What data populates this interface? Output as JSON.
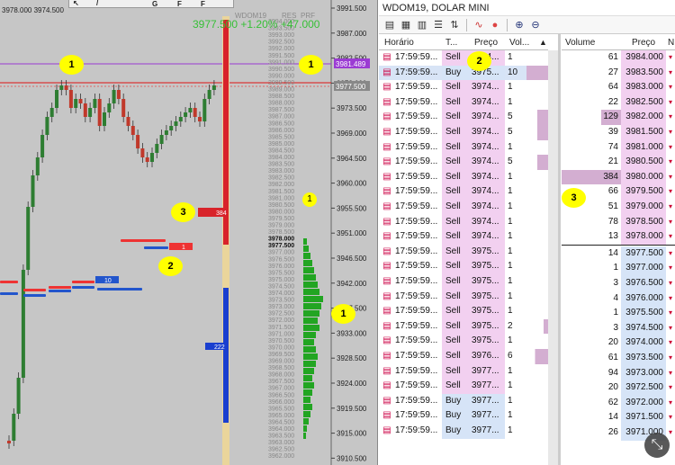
{
  "chart": {
    "header_left": "3978.000 3974.500",
    "toolbar": [
      "G",
      "F",
      "F"
    ],
    "top_info": "3977.500 +1.20% +47.000",
    "col_headers": [
      "WDOM19",
      "RES",
      "PRF"
    ],
    "price_labels": [
      "3991.500",
      "3987.000",
      "3982.500",
      "3978.000",
      "3973.500",
      "3969.000",
      "3964.500",
      "3960.000",
      "3955.500",
      "3951.000",
      "3946.500",
      "3942.000",
      "3937.500",
      "3933.000",
      "3928.500",
      "3924.000",
      "3919.500",
      "3915.000",
      "3910.500"
    ],
    "tag_purple": "3981.489",
    "tag_gray": "3977.500",
    "bar_label_blue": "10",
    "bar_label_red": "1",
    "bar_label_mid": "384",
    "bar_label_low": "222",
    "badges": [
      "1",
      "1",
      "1",
      "1",
      "2",
      "3"
    ],
    "dom_prices": [
      "3994.000",
      "3993.500",
      "3993.000",
      "3992.500",
      "3992.000",
      "3991.500",
      "3991.000",
      "3990.500",
      "3990.000",
      "3989.500",
      "3989.000",
      "3988.500",
      "3988.000",
      "3987.500",
      "3987.000",
      "3986.500",
      "3986.000",
      "3985.500",
      "3985.000",
      "3984.500",
      "3984.000",
      "3983.500",
      "3983.000",
      "3982.500",
      "3982.000",
      "3981.500",
      "3981.000",
      "3980.500",
      "3980.000",
      "3979.500",
      "3979.000",
      "3978.500",
      "3978.000",
      "3977.500",
      "3977.000",
      "3976.500",
      "3976.000",
      "3975.500",
      "3975.000",
      "3974.500",
      "3974.000",
      "3973.500",
      "3973.000",
      "3972.500",
      "3972.000",
      "3971.500",
      "3971.000",
      "3970.500",
      "3970.000",
      "3969.500",
      "3969.000",
      "3968.500",
      "3968.000",
      "3967.500",
      "3967.000",
      "3966.500",
      "3966.000",
      "3965.500",
      "3965.000",
      "3964.500",
      "3964.000",
      "3963.500",
      "3963.000",
      "3962.500",
      "3962.000"
    ]
  },
  "window": {
    "title": "WDOM19, DOLAR MINI",
    "toolbar_icons": [
      "chart-icon",
      "table-icon",
      "grid-icon",
      "list-icon",
      "sort-icon",
      "signal-icon",
      "filter-icon",
      "zoom-in-icon",
      "zoom-out-icon"
    ],
    "trades": {
      "headers": [
        "Horário",
        "T...",
        "Preço",
        "Vol..."
      ],
      "rows": [
        {
          "time": "17:59:59...",
          "type": "Sell",
          "price": "3974...",
          "vol": "1"
        },
        {
          "time": "17:59:59...",
          "type": "Buy",
          "price": "3975...",
          "vol": "10"
        },
        {
          "time": "17:59:59...",
          "type": "Sell",
          "price": "3974...",
          "vol": "1"
        },
        {
          "time": "17:59:59...",
          "type": "Sell",
          "price": "3974...",
          "vol": "1"
        },
        {
          "time": "17:59:59...",
          "type": "Sell",
          "price": "3974...",
          "vol": "5"
        },
        {
          "time": "17:59:59...",
          "type": "Sell",
          "price": "3974...",
          "vol": "5"
        },
        {
          "time": "17:59:59...",
          "type": "Sell",
          "price": "3974...",
          "vol": "1"
        },
        {
          "time": "17:59:59...",
          "type": "Sell",
          "price": "3974...",
          "vol": "5"
        },
        {
          "time": "17:59:59...",
          "type": "Sell",
          "price": "3974...",
          "vol": "1"
        },
        {
          "time": "17:59:59...",
          "type": "Sell",
          "price": "3974...",
          "vol": "1"
        },
        {
          "time": "17:59:59...",
          "type": "Sell",
          "price": "3974...",
          "vol": "1"
        },
        {
          "time": "17:59:59...",
          "type": "Sell",
          "price": "3974...",
          "vol": "1"
        },
        {
          "time": "17:59:59...",
          "type": "Sell",
          "price": "3974...",
          "vol": "1"
        },
        {
          "time": "17:59:59...",
          "type": "Sell",
          "price": "3975...",
          "vol": "1"
        },
        {
          "time": "17:59:59...",
          "type": "Sell",
          "price": "3975...",
          "vol": "1"
        },
        {
          "time": "17:59:59...",
          "type": "Sell",
          "price": "3975...",
          "vol": "1"
        },
        {
          "time": "17:59:59...",
          "type": "Sell",
          "price": "3975...",
          "vol": "1"
        },
        {
          "time": "17:59:59...",
          "type": "Sell",
          "price": "3975...",
          "vol": "1"
        },
        {
          "time": "17:59:59...",
          "type": "Sell",
          "price": "3975...",
          "vol": "2"
        },
        {
          "time": "17:59:59...",
          "type": "Sell",
          "price": "3975...",
          "vol": "1"
        },
        {
          "time": "17:59:59...",
          "type": "Sell",
          "price": "3976...",
          "vol": "6"
        },
        {
          "time": "17:59:59...",
          "type": "Sell",
          "price": "3977...",
          "vol": "1"
        },
        {
          "time": "17:59:59...",
          "type": "Sell",
          "price": "3977...",
          "vol": "1"
        },
        {
          "time": "17:59:59...",
          "type": "Buy",
          "price": "3977...",
          "vol": "1"
        },
        {
          "time": "17:59:59...",
          "type": "Buy",
          "price": "3977...",
          "vol": "1"
        },
        {
          "time": "17:59:59...",
          "type": "Buy",
          "price": "3977...",
          "vol": "1"
        }
      ]
    },
    "book": {
      "headers": [
        "Volume",
        "Preço",
        "N"
      ],
      "asks": [
        {
          "volume": "61",
          "price": "3984.000"
        },
        {
          "volume": "27",
          "price": "3983.500"
        },
        {
          "volume": "64",
          "price": "3983.000"
        },
        {
          "volume": "22",
          "price": "3982.500"
        },
        {
          "volume": "129",
          "price": "3982.000"
        },
        {
          "volume": "39",
          "price": "3981.500"
        },
        {
          "volume": "74",
          "price": "3981.000"
        },
        {
          "volume": "21",
          "price": "3980.500"
        },
        {
          "volume": "384",
          "price": "3980.000"
        },
        {
          "volume": "66",
          "price": "3979.500"
        },
        {
          "volume": "51",
          "price": "3979.000"
        },
        {
          "volume": "78",
          "price": "3978.500"
        },
        {
          "volume": "13",
          "price": "3978.000"
        }
      ],
      "bids": [
        {
          "volume": "14",
          "price": "3977.500"
        },
        {
          "volume": "1",
          "price": "3977.000"
        },
        {
          "volume": "3",
          "price": "3976.500"
        },
        {
          "volume": "4",
          "price": "3976.000"
        },
        {
          "volume": "1",
          "price": "3975.500"
        },
        {
          "volume": "3",
          "price": "3974.500"
        },
        {
          "volume": "20",
          "price": "3974.000"
        },
        {
          "volume": "61",
          "price": "3973.500"
        },
        {
          "volume": "94",
          "price": "3973.000"
        },
        {
          "volume": "20",
          "price": "3972.500"
        },
        {
          "volume": "62",
          "price": "3972.000"
        },
        {
          "volume": "14",
          "price": "3971.500"
        },
        {
          "volume": "26",
          "price": "3971.000"
        }
      ]
    }
  },
  "colors": {
    "sell": "#f2d0f0",
    "buy": "#d6e4f7",
    "bull": "#2e7d32",
    "bear": "#c0392b",
    "volbar": "#d3aed1"
  }
}
